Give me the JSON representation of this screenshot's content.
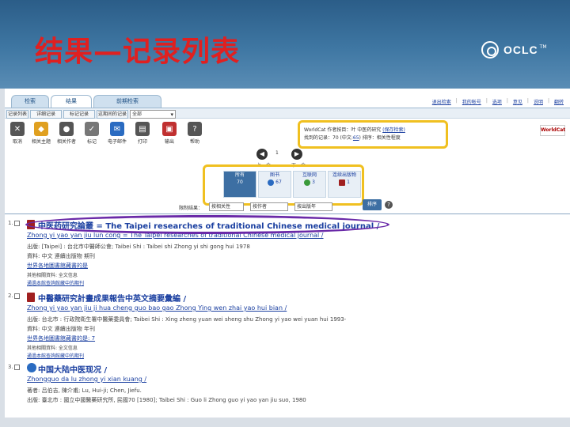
{
  "slide": {
    "title": "结果—记录列表",
    "logo_text": "OCLC",
    "logo_tm": "TM"
  },
  "tabs": [
    {
      "label": "检索",
      "active": false
    },
    {
      "label": "结果",
      "active": true
    },
    {
      "label": "前期检索",
      "active": false
    }
  ],
  "top_links": [
    "退出检索",
    "我的帐号",
    "选项",
    "意见",
    "说明",
    "翻转"
  ],
  "subtabs": [
    "记录列表",
    "详细记录",
    "标记记录",
    "这期间的记录"
  ],
  "subbar_select": "全部",
  "toolbar": [
    {
      "label": "取消",
      "icon": "x-icon",
      "color": "#555"
    },
    {
      "label": "相关主题",
      "icon": "tag-icon",
      "color": "#e0a020"
    },
    {
      "label": "相关作者",
      "icon": "person-icon",
      "color": "#555"
    },
    {
      "label": "标记",
      "icon": "check-icon",
      "color": "#777"
    },
    {
      "label": "电子邮件",
      "icon": "mail-icon",
      "color": "#2a6bc1"
    },
    {
      "label": "打印",
      "icon": "printer-icon",
      "color": "#555"
    },
    {
      "label": "输出",
      "icon": "export-icon",
      "color": "#c03030"
    },
    {
      "label": "帮助",
      "icon": "help-icon",
      "color": "#555"
    }
  ],
  "worldcat": {
    "line1_prefix": "WorldCat 作者按目：叶 中医药研究",
    "line1_link": "(保存检索)",
    "line2_prefix": "找到的记录：70 (中文:",
    "line2_link": "65",
    "line2_suffix": ") 排序：相关性程度",
    "badge": "WorldCat"
  },
  "pager": {
    "prev_label": "上一个",
    "next_label": "下一个",
    "page": "1"
  },
  "facets": [
    {
      "label": "所有",
      "count": "70",
      "active": true
    },
    {
      "label": "图书",
      "count": "67",
      "active": false
    },
    {
      "label": "互联网",
      "count": "3",
      "active": false
    },
    {
      "label": "连续出版物",
      "count": "1",
      "active": false
    }
  ],
  "sort": {
    "label": "限制结果：",
    "opt1": "按相关性",
    "opt2": "按作者",
    "opt3": "按出版年",
    "button": "排序"
  },
  "results": [
    {
      "num": "1.",
      "title": "中医药研究論叢 = The Taipei researches of traditional Chinese medical journal /",
      "pinyin": "Zhong yi yao yan jiu lun cong = The Taipei researches of traditional Chinese medical journal /",
      "line1": "出版: [Taipei] : 台北市中醫師公會; Taibei Shi : Taibei shi Zhong yi shi gong hui 1978",
      "line2": "資料: 中文 連續出版物 期刊",
      "line3": "世界各地圖書館藏書的是",
      "line4": "其他相關資料: 全文信息",
      "line5": "通過本館查詢館藏中的期刊"
    },
    {
      "num": "2.",
      "title": "中醫藥研究計畫成果報告中英文摘要彙編 /",
      "pinyin": "Zhong yi yao yan jiu ji hua cheng guo bao gao Zhong Ying wen zhai yao hui bian /",
      "line1": "出版: 台北市 : 行政院衛生署中醫藥委員會; Taibei Shi : Xing zheng yuan wei sheng shu Zhong yi yao wei yuan hui 1993-",
      "line2": "資料: 中文 連續出版物 年刊",
      "line3": "世界各地圖書館藏書的是: 7",
      "line4": "其他相關資料: 全文信息",
      "line5": "通過本館查詢館藏中的期刊"
    },
    {
      "num": "3.",
      "title": "中国大陆中医现况 /",
      "pinyin": "Zhongguo da lu zhong yi xian kuang /",
      "line1": "著者: 吕伯吉, 陳介甫; Lu, Hui-ji; Chen, Jiefu.",
      "line2": "出版: 臺北市 : 國立中國醫藥研究所, 民國70 [1980]; Taibei Shi : Guo li Zhong guo yi yao yan jiu suo, 1980"
    }
  ]
}
